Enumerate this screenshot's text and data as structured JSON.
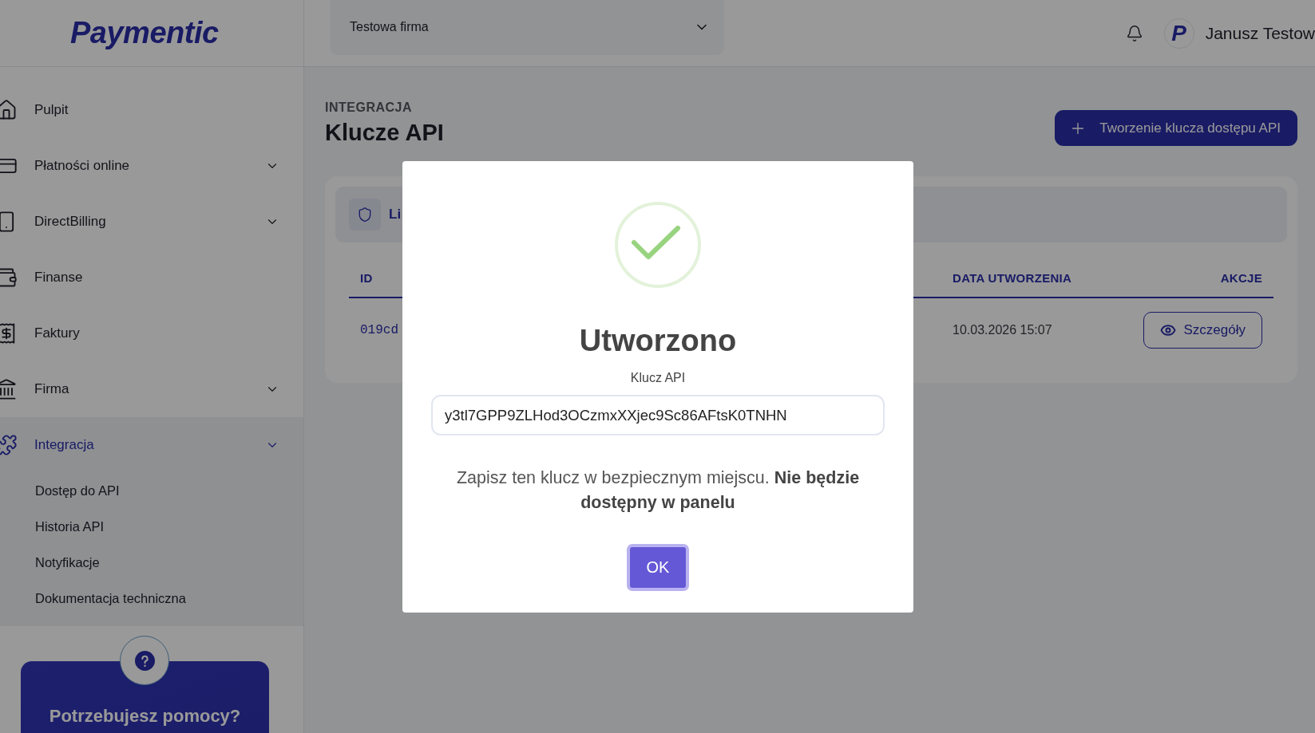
{
  "logo": "Paymentic",
  "company_select": {
    "value": "Testowa firma"
  },
  "user": {
    "avatar_logo": "P",
    "name": "Janusz Testow"
  },
  "sidebar": {
    "items": [
      {
        "kind": "link",
        "label": "Pulpit",
        "selected": false
      },
      {
        "kind": "group",
        "label": "Płatności online",
        "selected": false
      },
      {
        "kind": "group",
        "label": "DirectBilling",
        "selected": false
      },
      {
        "kind": "link",
        "label": "Finanse",
        "selected": false
      },
      {
        "kind": "link",
        "label": "Faktury",
        "selected": false
      },
      {
        "kind": "group",
        "label": "Firma",
        "selected": false
      },
      {
        "kind": "group",
        "label": "Integracja",
        "selected": true,
        "expanded": true,
        "children": [
          {
            "label": "Dostęp do API"
          },
          {
            "label": "Historia API"
          },
          {
            "label": "Notyfikacje"
          },
          {
            "label": "Dokumentacja techniczna"
          }
        ]
      }
    ],
    "help": {
      "title": "Potrzebujesz pomocy?"
    }
  },
  "page": {
    "breadcrumb": "INTEGRACJA",
    "title": "Klucze API",
    "create_button": "Tworzenie klucza dostępu API"
  },
  "card": {
    "header": "Li",
    "table": {
      "columns": [
        {
          "label": "ID"
        },
        {
          "label": "DATA UTWORZENIA"
        },
        {
          "label": "AKCJE"
        }
      ],
      "rows": [
        {
          "id": "019cd",
          "created": "10.03.2026 15:07",
          "action": "Szczegóły"
        }
      ]
    }
  },
  "modal": {
    "title": "Utworzono",
    "field_label": "Klucz API",
    "key": "y3tl7GPP9ZLHod3OCzmxXXjec9Sc86AFtsK0TNHN",
    "message": "Zapisz ten klucz w bezpiecznym miejscu. **Nie będzie dostępny w panelu**",
    "ok_button": "OK"
  }
}
